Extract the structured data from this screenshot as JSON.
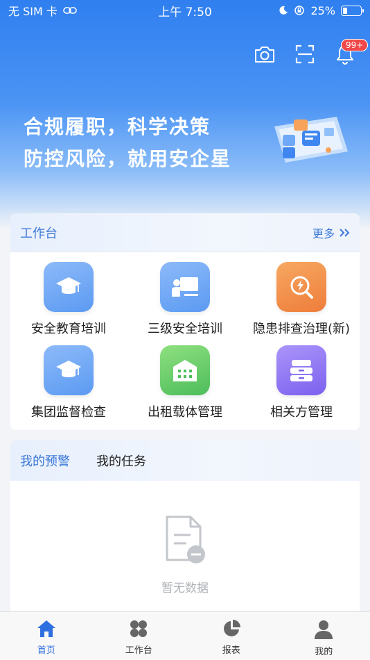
{
  "status_bar": {
    "carrier": "无 SIM 卡",
    "time": "上午 7:50",
    "battery": "25%",
    "battery_level": 0.25
  },
  "header": {
    "notification_badge": "99+"
  },
  "hero": {
    "line1": "合规履职，科学决策",
    "line2": "防控风险，就用安企星"
  },
  "workbench": {
    "title": "工作台",
    "more_label": "更多",
    "items": [
      {
        "label": "安全教育培训",
        "icon": "graduation-cap-icon"
      },
      {
        "label": "三级安全培训",
        "icon": "teacher-board-icon"
      },
      {
        "label": "隐患排查治理(新)",
        "icon": "hazard-search-icon"
      },
      {
        "label": "集团监督检查",
        "icon": "graduation-cap-icon"
      },
      {
        "label": "出租载体管理",
        "icon": "warehouse-icon"
      },
      {
        "label": "相关方管理",
        "icon": "cabinet-icon"
      }
    ]
  },
  "tasks": {
    "tabs": [
      {
        "label": "我的预警",
        "active": true
      },
      {
        "label": "我的任务",
        "active": false
      }
    ],
    "empty_text": "暂无数据"
  },
  "tabbar": {
    "items": [
      {
        "label": "首页",
        "icon": "home-icon",
        "active": true
      },
      {
        "label": "工作台",
        "icon": "grid-icon",
        "active": false
      },
      {
        "label": "报表",
        "icon": "pie-chart-icon",
        "active": false
      },
      {
        "label": "我的",
        "icon": "user-icon",
        "active": false
      }
    ]
  },
  "colors": {
    "primary": "#3c78d8",
    "badge": "#f04848",
    "hero_top": "#2f7ff0"
  }
}
